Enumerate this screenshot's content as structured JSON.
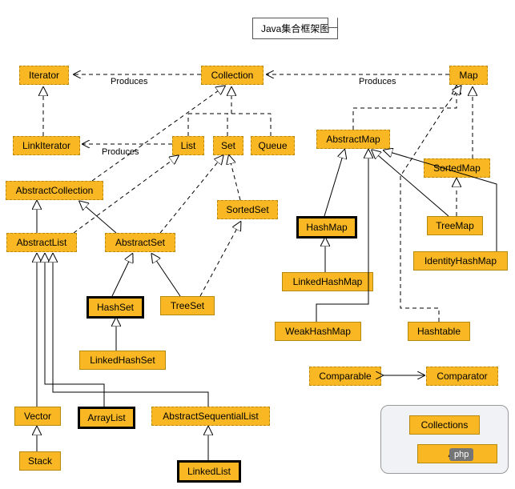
{
  "title": "Java集合框架图",
  "labels": {
    "produces": "Produces"
  },
  "nodes": {
    "iterator": "Iterator",
    "collection": "Collection",
    "map": "Map",
    "linkIterator": "LinkIterator",
    "list": "List",
    "set": "Set",
    "queue": "Queue",
    "abstractMap": "AbstractMap",
    "sortedMap": "SortedMap",
    "abstractCollection": "AbstractCollection",
    "sortedSet": "SortedSet",
    "hashMap": "HashMap",
    "treeMap": "TreeMap",
    "identityHashMap": "IdentityHashMap",
    "abstractList": "AbstractList",
    "abstractSet": "AbstractSet",
    "linkedHashMap": "LinkedHashMap",
    "hashSet": "HashSet",
    "treeSet": "TreeSet",
    "weakHashMap": "WeakHashMap",
    "hashtable": "Hashtable",
    "linkedHashSet": "LinkedHashSet",
    "comparable": "Comparable",
    "comparator": "Comparator",
    "vector": "Vector",
    "arrayList": "ArrayList",
    "abstractSequentialList": "AbstractSequentialList",
    "stack": "Stack",
    "linkedList": "LinkedList",
    "collections": "Collections",
    "arra": "Arra"
  },
  "watermark": "php",
  "chart_data": {
    "type": "diagram",
    "title": "Java集合框架图",
    "entities": [
      {
        "name": "Iterator",
        "kind": "interface"
      },
      {
        "name": "Collection",
        "kind": "interface"
      },
      {
        "name": "Map",
        "kind": "interface"
      },
      {
        "name": "LinkIterator",
        "kind": "interface"
      },
      {
        "name": "List",
        "kind": "interface"
      },
      {
        "name": "Set",
        "kind": "interface"
      },
      {
        "name": "Queue",
        "kind": "interface"
      },
      {
        "name": "AbstractMap",
        "kind": "abstract"
      },
      {
        "name": "SortedMap",
        "kind": "interface"
      },
      {
        "name": "AbstractCollection",
        "kind": "abstract"
      },
      {
        "name": "SortedSet",
        "kind": "interface"
      },
      {
        "name": "HashMap",
        "kind": "class"
      },
      {
        "name": "TreeMap",
        "kind": "class"
      },
      {
        "name": "IdentityHashMap",
        "kind": "class"
      },
      {
        "name": "AbstractList",
        "kind": "abstract"
      },
      {
        "name": "AbstractSet",
        "kind": "abstract"
      },
      {
        "name": "LinkedHashMap",
        "kind": "class"
      },
      {
        "name": "HashSet",
        "kind": "class"
      },
      {
        "name": "TreeSet",
        "kind": "class"
      },
      {
        "name": "WeakHashMap",
        "kind": "class"
      },
      {
        "name": "Hashtable",
        "kind": "class"
      },
      {
        "name": "LinkedHashSet",
        "kind": "class"
      },
      {
        "name": "Comparable",
        "kind": "interface"
      },
      {
        "name": "Comparator",
        "kind": "interface"
      },
      {
        "name": "Vector",
        "kind": "class"
      },
      {
        "name": "ArrayList",
        "kind": "class"
      },
      {
        "name": "AbstractSequentialList",
        "kind": "abstract"
      },
      {
        "name": "Stack",
        "kind": "class"
      },
      {
        "name": "LinkedList",
        "kind": "class"
      },
      {
        "name": "Collections",
        "kind": "utility"
      }
    ],
    "relationships": [
      {
        "from": "Collection",
        "to": "Iterator",
        "type": "produces"
      },
      {
        "from": "Map",
        "to": "Collection",
        "type": "produces"
      },
      {
        "from": "List",
        "to": "LinkIterator",
        "type": "produces"
      },
      {
        "from": "LinkIterator",
        "to": "Iterator",
        "type": "extends"
      },
      {
        "from": "List",
        "to": "Collection",
        "type": "extends"
      },
      {
        "from": "Set",
        "to": "Collection",
        "type": "extends"
      },
      {
        "from": "Queue",
        "to": "Collection",
        "type": "extends"
      },
      {
        "from": "AbstractMap",
        "to": "Map",
        "type": "implements"
      },
      {
        "from": "SortedMap",
        "to": "Map",
        "type": "extends"
      },
      {
        "from": "AbstractCollection",
        "to": "Collection",
        "type": "implements"
      },
      {
        "from": "SortedSet",
        "to": "Set",
        "type": "extends"
      },
      {
        "from": "AbstractList",
        "to": "AbstractCollection",
        "type": "extends"
      },
      {
        "from": "AbstractList",
        "to": "List",
        "type": "implements"
      },
      {
        "from": "AbstractSet",
        "to": "AbstractCollection",
        "type": "extends"
      },
      {
        "from": "AbstractSet",
        "to": "Set",
        "type": "implements"
      },
      {
        "from": "HashMap",
        "to": "AbstractMap",
        "type": "extends"
      },
      {
        "from": "TreeMap",
        "to": "AbstractMap",
        "type": "extends"
      },
      {
        "from": "TreeMap",
        "to": "SortedMap",
        "type": "implements"
      },
      {
        "from": "IdentityHashMap",
        "to": "AbstractMap",
        "type": "extends"
      },
      {
        "from": "LinkedHashMap",
        "to": "HashMap",
        "type": "extends"
      },
      {
        "from": "WeakHashMap",
        "to": "AbstractMap",
        "type": "extends"
      },
      {
        "from": "Hashtable",
        "to": "Map",
        "type": "implements"
      },
      {
        "from": "HashSet",
        "to": "AbstractSet",
        "type": "extends"
      },
      {
        "from": "TreeSet",
        "to": "AbstractSet",
        "type": "extends"
      },
      {
        "from": "TreeSet",
        "to": "SortedSet",
        "type": "implements"
      },
      {
        "from": "LinkedHashSet",
        "to": "HashSet",
        "type": "extends"
      },
      {
        "from": "Vector",
        "to": "AbstractList",
        "type": "extends"
      },
      {
        "from": "ArrayList",
        "to": "AbstractList",
        "type": "extends"
      },
      {
        "from": "AbstractSequentialList",
        "to": "AbstractList",
        "type": "extends"
      },
      {
        "from": "Stack",
        "to": "Vector",
        "type": "extends"
      },
      {
        "from": "LinkedList",
        "to": "AbstractSequentialList",
        "type": "extends"
      },
      {
        "from": "Comparable",
        "to": "Comparator",
        "type": "association"
      }
    ]
  }
}
